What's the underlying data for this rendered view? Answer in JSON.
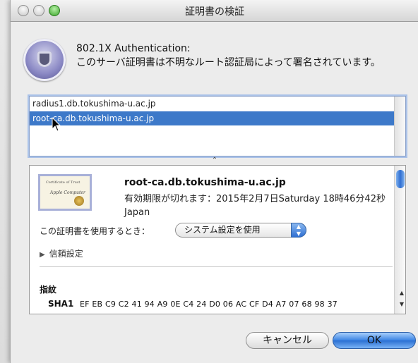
{
  "window": {
    "title": "証明書の検証"
  },
  "header": {
    "heading_line1": "802.1X Authentication:",
    "heading_line2": "このサーバ証明書は不明なルート認証局によって署名されています。",
    "icon": "certificate-shield-icon"
  },
  "cert_list": {
    "items": [
      {
        "label": "radius1.db.tokushima-u.ac.jp",
        "selected": false
      },
      {
        "label": "root-ca.db.tokushima-u.ac.jp",
        "selected": true
      }
    ]
  },
  "details": {
    "certificate_thumbnail_icon": "certificate-document-icon",
    "common_name": "root-ca.db.tokushima-u.ac.jp",
    "expiry_text": "有効期限が切れます：2015年2月7日Saturday 18時46分42秒Japan",
    "use_label": "この証明書を使用するとき：",
    "use_value": "システム設定を使用",
    "trust_disclosure": "信頼設定",
    "fingerprint_heading": "指紋",
    "sha1_label": "SHA1",
    "sha1_value": "EF EB C9 C2 41 94 A9 0E C4 24 D0 06 AC CF D4 A7 07 68 98 37"
  },
  "buttons": {
    "cancel": "キャンセル",
    "ok": "OK"
  },
  "colors": {
    "selection": "#3d79c9",
    "default_button": "#3a82e3",
    "window_bg": "#ececec"
  }
}
